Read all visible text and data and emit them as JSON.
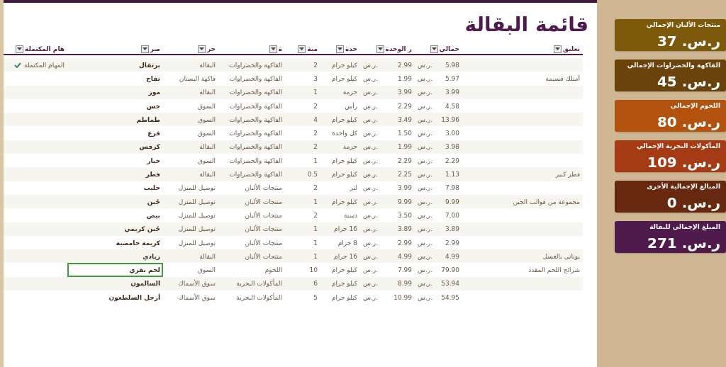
{
  "title": "قائمة البقالة",
  "columns": [
    "تعليق",
    "جمالي",
    "ر الوحدة",
    "حدة",
    "مية",
    "ة",
    "جر",
    "صر",
    "هام المكتملة"
  ],
  "rows": [
    {
      "comment": "",
      "total": {
        "symbol": "ر.س.",
        "value": "5.98"
      },
      "unit_price": {
        "symbol": "ر.س.",
        "value": "2.99"
      },
      "unit": "كيلو جرام",
      "qty": "2",
      "category": "الفاكهة والخضراوات",
      "store": "البقالة",
      "item": "برتقال",
      "completed": true,
      "task_note": "المهام المكتملة",
      "selected": false
    },
    {
      "comment": "أمتلك قسيمة",
      "total": {
        "symbol": "ر.س.",
        "value": "5.97"
      },
      "unit_price": {
        "symbol": "ر.س.",
        "value": "1.99"
      },
      "unit": "كيلو جرام",
      "qty": "3",
      "category": "الفاكهة والخضراوات",
      "store": "فاكهة البستان",
      "item": "تفاح",
      "completed": false,
      "selected": false
    },
    {
      "comment": "",
      "total": {
        "symbol": "ر.س.",
        "value": "3.99"
      },
      "unit_price": {
        "symbol": "ر.س.",
        "value": "3.99"
      },
      "unit": "حزمة",
      "qty": "1",
      "category": "الفاكهة والخضراوات",
      "store": "البقالة",
      "item": "موز",
      "completed": false,
      "selected": false
    },
    {
      "comment": "",
      "total": {
        "symbol": "ر.س.",
        "value": "4.58"
      },
      "unit_price": {
        "symbol": "ر.س.",
        "value": "2.29"
      },
      "unit": "رأس",
      "qty": "2",
      "category": "الفاكهة والخضراوات",
      "store": "السوق",
      "item": "خس",
      "completed": false,
      "selected": false
    },
    {
      "comment": "",
      "total": {
        "symbol": "ر.س.",
        "value": "13.96"
      },
      "unit_price": {
        "symbol": "ر.س.",
        "value": "3.49"
      },
      "unit": "كيلو جرام",
      "qty": "4",
      "category": "الفاكهة والخضراوات",
      "store": "السوق",
      "item": "طماطم",
      "completed": false,
      "selected": false
    },
    {
      "comment": "",
      "total": {
        "symbol": "ر.س.",
        "value": "3.00"
      },
      "unit_price": {
        "symbol": "ر.س.",
        "value": "1.50"
      },
      "unit": "كل واحدة",
      "qty": "2",
      "category": "الفاكهة والخضراوات",
      "store": "السوق",
      "item": "قرع",
      "completed": false,
      "selected": false
    },
    {
      "comment": "",
      "total": {
        "symbol": "ر.س.",
        "value": "3.98"
      },
      "unit_price": {
        "symbol": "ر.س.",
        "value": "1.99"
      },
      "unit": "حزمة",
      "qty": "2",
      "category": "الفاكهة والخضراوات",
      "store": "البقالة",
      "item": "كرفس",
      "completed": false,
      "selected": false
    },
    {
      "comment": "",
      "total": {
        "symbol": "ر.س.",
        "value": "2.29"
      },
      "unit_price": {
        "symbol": "ر.س.",
        "value": "2.29"
      },
      "unit": "كيلو جرام",
      "qty": "1",
      "category": "الفاكهة والخضراوات",
      "store": "السوق",
      "item": "خيار",
      "completed": false,
      "selected": false
    },
    {
      "comment": "فطر كبير",
      "total": {
        "symbol": "ر.س.",
        "value": "1.13"
      },
      "unit_price": {
        "symbol": "ر.س.",
        "value": "2.25"
      },
      "unit": "كيلو جرام",
      "qty": "0.5",
      "category": "الفاكهة والخضراوات",
      "store": "البقالة",
      "item": "فطر",
      "completed": false,
      "selected": false
    },
    {
      "comment": "",
      "total": {
        "symbol": "ر.س.",
        "value": "7.98"
      },
      "unit_price": {
        "symbol": "ر.س.",
        "value": "3.99"
      },
      "unit": "لتر",
      "qty": "2",
      "category": "منتجات الألبان",
      "store": "توصيل للمنزل",
      "item": "حليب",
      "completed": false,
      "selected": false
    },
    {
      "comment": "مجموعة من قوالب الجبن",
      "total": {
        "symbol": "ر.س.",
        "value": "9.99"
      },
      "unit_price": {
        "symbol": "ر.س.",
        "value": "9.99"
      },
      "unit": "كيلو جرام",
      "qty": "1",
      "category": "منتجات الألبان",
      "store": "توصيل للمنزل",
      "item": "جُبن",
      "completed": false,
      "selected": false
    },
    {
      "comment": "",
      "total": {
        "symbol": "ر.س.",
        "value": "7.00"
      },
      "unit_price": {
        "symbol": "ر.س.",
        "value": "3.50"
      },
      "unit": "دستة",
      "qty": "2",
      "category": "منتجات الألبان",
      "store": "توصيل للمنزل",
      "item": "بيض",
      "completed": false,
      "selected": false
    },
    {
      "comment": "",
      "total": {
        "symbol": "ر.س.",
        "value": "3.89"
      },
      "unit_price": {
        "symbol": "ر.س.",
        "value": "3.89"
      },
      "unit": "16 جرام",
      "qty": "1",
      "category": "منتجات الألبان",
      "store": "توصيل للمنزل",
      "item": "جُبن كريمي",
      "completed": false,
      "selected": false
    },
    {
      "comment": "",
      "total": {
        "symbol": "ر.س.",
        "value": "2.99"
      },
      "unit_price": {
        "symbol": "ر.س.",
        "value": "2.99"
      },
      "unit": "8 جرام",
      "qty": "1",
      "category": "منتجات الألبان",
      "store": "توصيل للمنزل",
      "item": "كريمة حامضية",
      "completed": false,
      "selected": false
    },
    {
      "comment": "يوناني بالعسل",
      "total": {
        "symbol": "ر.س.",
        "value": "4.99"
      },
      "unit_price": {
        "symbol": "ر.س.",
        "value": "4.99"
      },
      "unit": "16 جرام",
      "qty": "1",
      "category": "منتجات الألبان",
      "store": "البقالة",
      "item": "زبادي",
      "completed": false,
      "selected": false
    },
    {
      "comment": "شرائح اللحم المقدد",
      "total": {
        "symbol": "ر.س.",
        "value": "79.90"
      },
      "unit_price": {
        "symbol": "ر.س.",
        "value": "7.99"
      },
      "unit": "كيلو جرام",
      "qty": "10",
      "category": "اللحوم",
      "store": "السوق",
      "item": "لحم بقري",
      "completed": false,
      "selected": true
    },
    {
      "comment": "",
      "total": {
        "symbol": "ر.س.",
        "value": "53.94"
      },
      "unit_price": {
        "symbol": "ر.س.",
        "value": "8.99"
      },
      "unit": "كيلو جرام",
      "qty": "6",
      "category": "المأكولات البحرية",
      "store": "سوق الأسماك",
      "item": "السالمون",
      "completed": false,
      "selected": false
    },
    {
      "comment": "",
      "total": {
        "symbol": "ر.س.",
        "value": "54.95"
      },
      "unit_price": {
        "symbol": "ر.س.",
        "value": "10.99"
      },
      "unit": "كيلو جرام",
      "qty": "5",
      "category": "المأكولات البحرية",
      "store": "سوق الأسماك",
      "item": "أرجل السلطعون",
      "completed": false,
      "selected": false
    }
  ],
  "summary_cards": [
    {
      "label": "منتجات الألبان الإجمالي",
      "value": "ر.س. 37",
      "color": "#7d5a0b"
    },
    {
      "label": "الفاكهة والخضراوات الإجمالي",
      "value": "ر.س. 45",
      "color": "#6a420b"
    },
    {
      "label": "اللحوم الإجمالي",
      "value": "ر.س. 80",
      "color": "#b3520f"
    },
    {
      "label": "المأكولات البحرية الإجمالي",
      "value": "ر.س. 109",
      "color": "#a43b14"
    },
    {
      "label": "المبالغ الإجمالية الأخرى",
      "value": "ر.س. 0",
      "color": "#66290f"
    },
    {
      "label": "المبلغ الإجمالي للبقالة",
      "value": "ر.س. 271",
      "color": "#4f1a4c"
    }
  ]
}
